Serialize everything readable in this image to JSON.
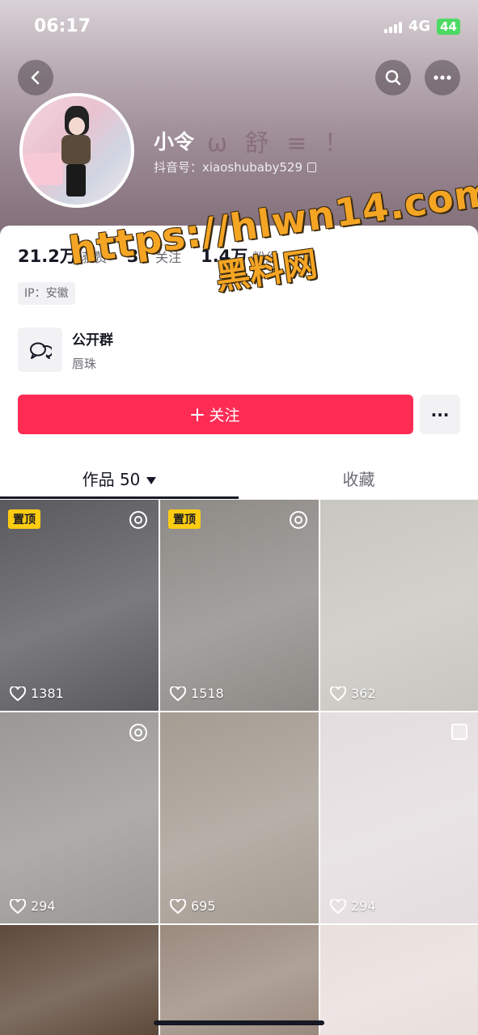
{
  "status_bar": {
    "time": "06:17",
    "network": "4G",
    "battery": "44"
  },
  "header": {
    "nickname": "小令",
    "deco": "ω 舒 ≡ ！",
    "douyin_id": "抖音号：xiaoshubaby529"
  },
  "stats": [
    {
      "num": "21.2万",
      "label": "获赞"
    },
    {
      "num": "37",
      "label": "关注"
    },
    {
      "num": "1.4万",
      "label": "粉丝"
    }
  ],
  "ip": "IP：安徽",
  "watermark": {
    "url": "https://hlwn14.com",
    "sub": "黑料网"
  },
  "group": {
    "title": "公开群",
    "subtitle": "唇珠"
  },
  "follow": {
    "label": "关注",
    "more": "···"
  },
  "tabs": {
    "works": "作品 50",
    "favorites": "收藏"
  },
  "tiles": [
    {
      "likes": "1381",
      "pinned": "置顶",
      "badge": "live",
      "bg": "#5a5a5e"
    },
    {
      "likes": "1518",
      "pinned": "置顶",
      "badge": "live",
      "bg": "#8d8a86"
    },
    {
      "likes": "362",
      "pinned": "",
      "badge": "",
      "bg": "#c8c6c0"
    },
    {
      "likes": "294",
      "pinned": "",
      "badge": "live",
      "bg": "#9a9894"
    },
    {
      "likes": "695",
      "pinned": "",
      "badge": "",
      "bg": "#a59c92"
    },
    {
      "likes": "294",
      "pinned": "",
      "badge": "multi",
      "bg": "#e4dde0"
    },
    {
      "likes": "",
      "pinned": "",
      "badge": "",
      "bg": "#5e4a3a"
    },
    {
      "likes": "",
      "pinned": "",
      "badge": "",
      "bg": "#9b8a7e"
    },
    {
      "likes": "",
      "pinned": "",
      "badge": "",
      "bg": "#e9dfdc"
    }
  ],
  "colors": {
    "accent": "#fe2c55",
    "pin": "#fecc11",
    "watermark": "#f5a524"
  }
}
